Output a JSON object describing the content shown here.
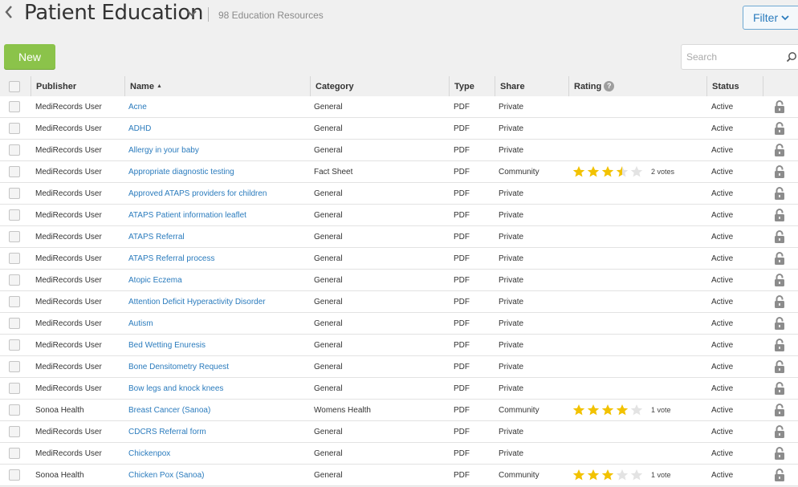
{
  "header": {
    "title": "Patient Education",
    "resource_count": "98 Education Resources",
    "filter_label": "Filter"
  },
  "toolbar": {
    "new_label": "New",
    "search_placeholder": "Search"
  },
  "table": {
    "columns": {
      "publisher": "Publisher",
      "name": "Name",
      "category": "Category",
      "type": "Type",
      "share": "Share",
      "rating": "Rating",
      "status": "Status"
    },
    "rows": [
      {
        "publisher": "MediRecords User",
        "name": "Acne",
        "category": "General",
        "type": "PDF",
        "share": "Private",
        "rating": null,
        "votes": "",
        "status": "Active"
      },
      {
        "publisher": "MediRecords User",
        "name": "ADHD",
        "category": "General",
        "type": "PDF",
        "share": "Private",
        "rating": null,
        "votes": "",
        "status": "Active"
      },
      {
        "publisher": "MediRecords User",
        "name": "Allergy in your baby",
        "category": "General",
        "type": "PDF",
        "share": "Private",
        "rating": null,
        "votes": "",
        "status": "Active"
      },
      {
        "publisher": "MediRecords User",
        "name": "Appropriate diagnostic testing",
        "category": "Fact Sheet",
        "type": "PDF",
        "share": "Community",
        "rating": 3.5,
        "votes": "2 votes",
        "status": "Active"
      },
      {
        "publisher": "MediRecords User",
        "name": "Approved ATAPS providers for children",
        "category": "General",
        "type": "PDF",
        "share": "Private",
        "rating": null,
        "votes": "",
        "status": "Active"
      },
      {
        "publisher": "MediRecords User",
        "name": "ATAPS Patient information leaflet",
        "category": "General",
        "type": "PDF",
        "share": "Private",
        "rating": null,
        "votes": "",
        "status": "Active"
      },
      {
        "publisher": "MediRecords User",
        "name": "ATAPS Referral",
        "category": "General",
        "type": "PDF",
        "share": "Private",
        "rating": null,
        "votes": "",
        "status": "Active"
      },
      {
        "publisher": "MediRecords User",
        "name": "ATAPS Referral process",
        "category": "General",
        "type": "PDF",
        "share": "Private",
        "rating": null,
        "votes": "",
        "status": "Active"
      },
      {
        "publisher": "MediRecords User",
        "name": "Atopic Eczema",
        "category": "General",
        "type": "PDF",
        "share": "Private",
        "rating": null,
        "votes": "",
        "status": "Active"
      },
      {
        "publisher": "MediRecords User",
        "name": "Attention Deficit Hyperactivity Disorder",
        "category": "General",
        "type": "PDF",
        "share": "Private",
        "rating": null,
        "votes": "",
        "status": "Active"
      },
      {
        "publisher": "MediRecords User",
        "name": "Autism",
        "category": "General",
        "type": "PDF",
        "share": "Private",
        "rating": null,
        "votes": "",
        "status": "Active"
      },
      {
        "publisher": "MediRecords User",
        "name": "Bed Wetting Enuresis",
        "category": "General",
        "type": "PDF",
        "share": "Private",
        "rating": null,
        "votes": "",
        "status": "Active"
      },
      {
        "publisher": "MediRecords User",
        "name": "Bone Densitometry Request",
        "category": "General",
        "type": "PDF",
        "share": "Private",
        "rating": null,
        "votes": "",
        "status": "Active"
      },
      {
        "publisher": "MediRecords User",
        "name": "Bow legs and knock knees",
        "category": "General",
        "type": "PDF",
        "share": "Private",
        "rating": null,
        "votes": "",
        "status": "Active"
      },
      {
        "publisher": "Sonoa Health",
        "name": "Breast Cancer (Sanoa)",
        "category": "Womens Health",
        "type": "PDF",
        "share": "Community",
        "rating": 4,
        "votes": "1 vote",
        "status": "Active"
      },
      {
        "publisher": "MediRecords User",
        "name": "CDCRS Referral form",
        "category": "General",
        "type": "PDF",
        "share": "Private",
        "rating": null,
        "votes": "",
        "status": "Active"
      },
      {
        "publisher": "MediRecords User",
        "name": "Chickenpox",
        "category": "General",
        "type": "PDF",
        "share": "Private",
        "rating": null,
        "votes": "",
        "status": "Active"
      },
      {
        "publisher": "Sonoa Health",
        "name": "Chicken Pox (Sanoa)",
        "category": "General",
        "type": "PDF",
        "share": "Community",
        "rating": 3,
        "votes": "1 vote",
        "status": "Active"
      }
    ]
  },
  "colors": {
    "accent_blue": "#2a7bbd",
    "new_button_green": "#8bc34a",
    "star_gold": "#f2c200",
    "star_empty": "#e3e3e3"
  },
  "icons": {
    "back": "chevron-left-icon",
    "title_dropdown": "chevron-down-icon",
    "filter": "chevron-down-icon",
    "search": "search-icon",
    "rating_help": "question-icon",
    "row_action": "lock-icon"
  }
}
